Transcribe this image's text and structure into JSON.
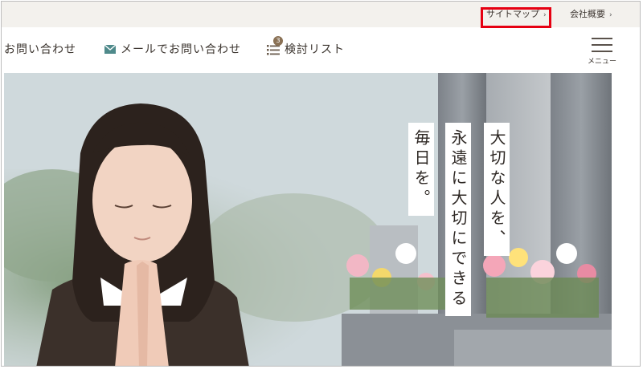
{
  "topbar": {
    "sitemap_label": "サイトマップ",
    "company_label": "会社概要",
    "chevron": "›"
  },
  "nav": {
    "phone_label": "お問い合わせ",
    "mail_label": "メールでお問い合わせ",
    "list_label": "検討リスト",
    "list_count": "3",
    "menu_label": "メニュー"
  },
  "hero": {
    "taglines": [
      "大切な人を、",
      "永遠に大切にできる",
      "毎日を。"
    ]
  },
  "colors": {
    "highlight": "#e60012",
    "badge": "#8a7155",
    "topbar_bg": "#f3f1ed"
  }
}
